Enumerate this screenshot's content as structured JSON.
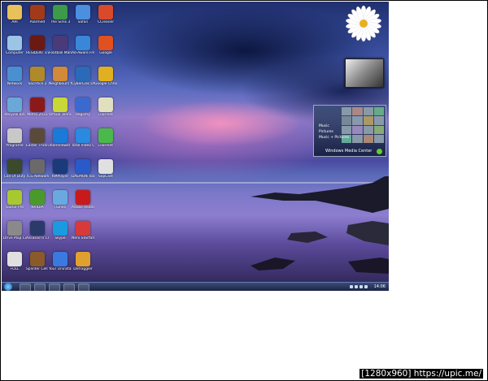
{
  "desktop": {
    "icons": [
      {
        "label": "ARI",
        "color": "#e8c15a"
      },
      {
        "label": "Alarmed",
        "color": "#a23a1a"
      },
      {
        "label": "The Sims 3",
        "color": "#3c9a4a"
      },
      {
        "label": "Safari",
        "color": "#4a8fe0"
      },
      {
        "label": "CCleaner",
        "color": "#d84a2a"
      },
      {
        "label": "Computer",
        "color": "#9bc4e6"
      },
      {
        "label": "RESIDENT EVIL 5",
        "color": "#6b1a12"
      },
      {
        "label": "Football Manager",
        "color": "#4a3a7a"
      },
      {
        "label": "Ad-Aware Free",
        "color": "#3a86d8"
      },
      {
        "label": "Google",
        "color": "#e05020"
      },
      {
        "label": "Network",
        "color": "#4a90d0"
      },
      {
        "label": "Sacrifice 2",
        "color": "#b08a2a"
      },
      {
        "label": "Neighbours from Hell",
        "color": "#d08a3a"
      },
      {
        "label": "CyberLink DVD suite",
        "color": "#2a6ab8"
      },
      {
        "label": "Google Chrome",
        "color": "#e0b020"
      },
      {
        "label": "Recycle Bin",
        "color": "#6aa8d8"
      },
      {
        "label": "Metro 2033",
        "color": "#8a1a1a"
      },
      {
        "label": "Virtual Tennis 2009",
        "color": "#c8d838"
      },
      {
        "label": "Registry",
        "color": "#3a6ad0"
      },
      {
        "label": "uTorrent",
        "color": "#e0e0c0"
      },
      {
        "label": "Programe",
        "color": "#c8c8c8"
      },
      {
        "label": "Easter Throne",
        "color": "#5a4a3a"
      },
      {
        "label": "TeamViewer 7",
        "color": "#1a7ad8"
      },
      {
        "label": "Total Video Converter",
        "color": "#2a8ae0"
      },
      {
        "label": "uTorrent",
        "color": "#4ab84a"
      },
      {
        "label": "Call Of Duty",
        "color": "#3a4a2a"
      },
      {
        "label": "TCG Network",
        "color": "#6a6a6a"
      },
      {
        "label": "KMPlayer",
        "color": "#1a3a7a"
      },
      {
        "label": "DAEMON Tools Lite",
        "color": "#2a5ac8"
      },
      {
        "label": "SopCast",
        "color": "#e0e0e0"
      },
      {
        "label": "Guitar Pro",
        "color": "#a8c830"
      },
      {
        "label": "NVIDIA",
        "color": "#4a9a2a"
      },
      {
        "label": "iTunes",
        "color": "#6aa8e0"
      },
      {
        "label": "Adobe Reader",
        "color": "#c81a1a"
      },
      {
        "label": "",
        "color": "rgba(0,0,0,0)"
      },
      {
        "label": "Drive Map City",
        "color": "#8a8a8a"
      },
      {
        "label": "Assassin's Creed 2",
        "color": "#2a3a6a"
      },
      {
        "label": "Skype",
        "color": "#1a9ae0"
      },
      {
        "label": "Nero StartSmart",
        "color": "#d83a3a"
      },
      {
        "label": "",
        "color": "rgba(0,0,0,0)"
      },
      {
        "label": "FOLL",
        "color": "#e0e0e0"
      },
      {
        "label": "Splinter Cell Conviction",
        "color": "#8a5a2a"
      },
      {
        "label": "Your Uninstaller",
        "color": "#3a7ae0"
      },
      {
        "label": "Defraggler",
        "color": "#e0a030"
      },
      {
        "label": "",
        "color": "rgba(0,0,0,0)"
      }
    ]
  },
  "gadgets": {
    "wmc_menu": [
      "Music",
      "Pictures",
      "Music + Pictures"
    ],
    "wmc_title": "Windows Media Center"
  },
  "taskbar": {
    "clock": "14:06"
  },
  "watermark": "[1280x960] https://upic.me/"
}
